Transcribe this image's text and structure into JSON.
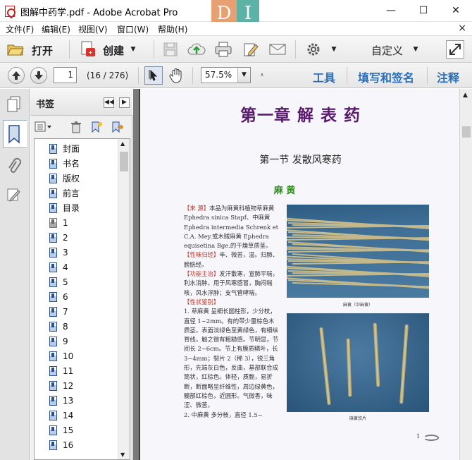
{
  "window": {
    "title": "图解中药学.pdf - Adobe Acrobat Pro",
    "logo_letters": [
      "D",
      "I"
    ]
  },
  "menu": [
    "文件(F)",
    "编辑(E)",
    "视图(V)",
    "窗口(W)",
    "帮助(H)"
  ],
  "toolbar": {
    "open_label": "打开",
    "create_label": "创建",
    "customize_label": "自定义"
  },
  "nav": {
    "page_number": "1",
    "page_info": "(16 / 276)",
    "zoom": "57.5%",
    "tabs": [
      "工具",
      "填写和签名",
      "注释"
    ]
  },
  "bookmarks": {
    "title": "书签",
    "items": [
      "封面",
      "书名",
      "版权",
      "前言",
      "目录",
      "1",
      "2",
      "3",
      "4",
      "5",
      "6",
      "7",
      "8",
      "9",
      "10",
      "11",
      "12",
      "13",
      "14",
      "15",
      "16"
    ]
  },
  "page": {
    "chapter_title": "第一章  解  表  药",
    "section_title": "第一节   发散风寒药",
    "herb_name": "麻    黄",
    "body_paragraphs": [
      {
        "tag": "【来    源】",
        "text": "本品为麻黄科植物草麻黄 Ephedra sinica Stapf、中麻黄 Ephedra intermedia Schrenk et C.A. Mey.或木贼麻黄 Ephedra equisetina Bge.的干燥草质茎。"
      },
      {
        "tag": "【性味归经】",
        "text": "辛、微苦，温。归肺、膀胱经。"
      },
      {
        "tag": "【功能主治】",
        "text": "发汗散寒，宣肺平喘，利水消肿。用于风寒感冒，胸闷喘咳，风水浮肿；支气管哮喘。"
      },
      {
        "tag": "【性状鉴别】",
        "text": ""
      },
      {
        "tag": "",
        "text": "1. 草麻黄   呈细长圆柱形，少分枝，直径 1~2mm。有的带少量棕色木质茎。表面淡绿色至黄绿色，有细纵脊线，触之微有粗糙感。节明显，节间长 2~6cm。节上有膜质鳞叶，长 3~4mm；裂片 2（稀 3），锐三角形，先端灰白色，反曲，基部联合成筒状，红棕色。体轻，质脆，易折断，断面略呈纤维性，周边绿黄色，髓部红棕色，近圆形。气微香，味涩、微苦。"
      },
      {
        "tag": "",
        "text": "2. 中麻黄   多分枝，直径 1.5~"
      }
    ],
    "caption_1": "麻黄（中麻黄）",
    "caption_2": "麻黄饮片",
    "page_number_printed": "1"
  }
}
